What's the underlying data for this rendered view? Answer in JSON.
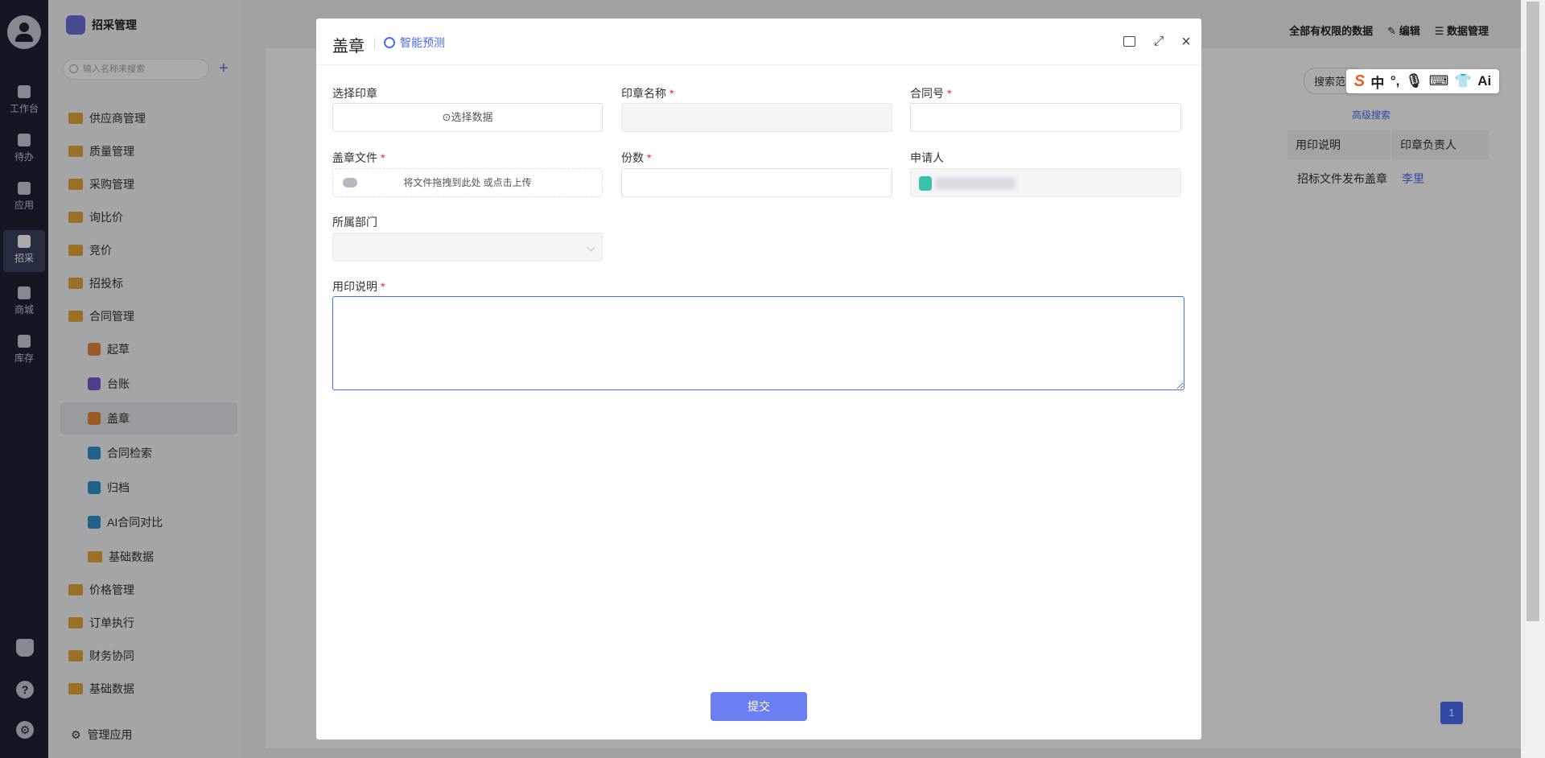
{
  "rail": {
    "items": [
      {
        "label": "工作台"
      },
      {
        "label": "待办"
      },
      {
        "label": "应用"
      },
      {
        "label": "招采"
      },
      {
        "label": "商城"
      },
      {
        "label": "库存"
      }
    ]
  },
  "sidebar": {
    "app_title": "招采管理",
    "search_placeholder": "输入名称来搜索",
    "items": [
      {
        "label": "供应商管理"
      },
      {
        "label": "质量管理"
      },
      {
        "label": "采购管理"
      },
      {
        "label": "询比价"
      },
      {
        "label": "竞价"
      },
      {
        "label": "招投标"
      },
      {
        "label": "合同管理"
      },
      {
        "label": "起草"
      },
      {
        "label": "台账"
      },
      {
        "label": "盖章"
      },
      {
        "label": "合同检索"
      },
      {
        "label": "归档"
      },
      {
        "label": "AI合同对比"
      },
      {
        "label": "基础数据"
      },
      {
        "label": "价格管理"
      },
      {
        "label": "订单执行"
      },
      {
        "label": "财务协同"
      },
      {
        "label": "基础数据"
      }
    ],
    "manage_label": "管理应用"
  },
  "background": {
    "scope_label": "全部有权限的数据",
    "edit_label": "编辑",
    "data_manage_label": "数据管理",
    "search_scope": "搜索范围",
    "advanced_search": "高级搜索",
    "columns": [
      "用印说明",
      "印章负责人"
    ],
    "row": {
      "usage": "招标文件发布盖章",
      "owner": "李里"
    },
    "page": "1"
  },
  "ime": {
    "items": [
      "中",
      "°,",
      "🎙",
      "⌨",
      "👕",
      "Ai"
    ]
  },
  "modal": {
    "title": "盖章",
    "smart_predict": "智能预测",
    "fields": {
      "seal_select": {
        "label": "选择印章",
        "button": "选择数据"
      },
      "seal_name": {
        "label": "印章名称",
        "value": ""
      },
      "contract_no": {
        "label": "合同号",
        "value": ""
      },
      "file": {
        "label": "盖章文件",
        "hint": "将文件拖拽到此处 或点击上传"
      },
      "copies": {
        "label": "份数",
        "value": ""
      },
      "applicant": {
        "label": "申请人"
      },
      "department": {
        "label": "所属部门",
        "value": ""
      },
      "usage": {
        "label": "用印说明",
        "value": ""
      }
    },
    "submit_label": "提交"
  },
  "colors": {
    "accent": "#4a6cf7",
    "submit": "#6b7ff2",
    "rail": "#1d2335",
    "required": "#f5222d"
  }
}
